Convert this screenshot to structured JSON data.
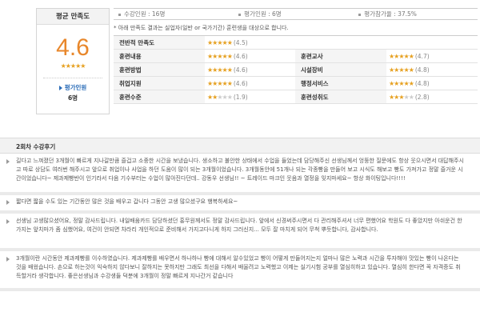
{
  "summary": {
    "title": "평균 만족도",
    "score": "4.6",
    "stars": "★★★★★",
    "rater_label": "평가인원",
    "rater_count": "6명"
  },
  "stats": [
    {
      "label": "수강인원 : 16명"
    },
    {
      "label": "평가인원 : 6명"
    },
    {
      "label": "평가참가율 : 37.5%"
    }
  ],
  "note": "* 아래 만족도 결과는 실업자(일반 or 국가기간) 훈련생을 대상으로 합니다.",
  "grid": {
    "overall": {
      "label": "전반적 만족도",
      "filled": "★★★★★",
      "empty": "",
      "score": "(4.5)"
    },
    "rows": [
      [
        {
          "label": "훈련내용",
          "filled": "★★★★★",
          "empty": "",
          "score": "(4.6)"
        },
        {
          "label": "훈련교사",
          "filled": "★★★★★",
          "empty": "",
          "score": "(4.7)"
        }
      ],
      [
        {
          "label": "훈련방법",
          "filled": "★★★★★",
          "empty": "",
          "score": "(4.6)"
        },
        {
          "label": "시설장비",
          "filled": "★★★★★",
          "empty": "",
          "score": "(4.8)"
        }
      ],
      [
        {
          "label": "취업지원",
          "filled": "★★★★★",
          "empty": "",
          "score": "(4.6)"
        },
        {
          "label": "행정서비스",
          "filled": "★★★★★",
          "empty": "",
          "score": "(4.8)"
        }
      ],
      [
        {
          "label": "훈련수준",
          "filled": "★★",
          "empty": "★★★",
          "score": "(1.9)"
        },
        {
          "label": "훈련성취도",
          "filled": "★★★",
          "empty": "★★",
          "score": "(2.8)"
        }
      ]
    ]
  },
  "reviews": {
    "title": "2회차 수강후기",
    "items": [
      {
        "text": "길다고 느껴졌던 3개월이 빠르게 지나갈만큼 즐겁고 소중한 시간을 보냈습니다. 생소하고 불안한 상태에서 수업을 들었는데 담당해주신 선생님께서 엉뚱한 질문에도 항상 웃으시면서 대답해주시고 따로 상담도 여러번 해주시고 앞으로 취업이나 사업을 하던 도움이 많이 되는 3개월이었습니다. 3개월동안에 51개나 되는 각종빵을 만들어 보고 시식도 해보고 빵도 가져가고 정말 즐거운 시간이었습니다~ 제과제빵반이 인기라서 다음 기수부터는 수업이 많아진다던데.. 강동우 선생님!! ~ 트레이드 마크인 웃음과 열정을 잊지마세요~ 항상 화이팅입니다!!!!"
      },
      {
        "text": "짧다면 짧을 수도 있는 기간동안 많은 것을 배우고 갑니다 그동안 고생 많으셨구요 행복하세요~"
      },
      {
        "text": "선생님 고생많으셨어요, 정말 감사드립니다. 내일배움카드 담당하셨던 홍무원께서도 정말 감사드립니다. 앞에서 신경써주시면서 다 관리해주셔서 너무 편했어요 학원도 다 좋았지만 아쉬운건 한가지는 앞치마가 좀 심했어요, 여건이 안되면 차라리 개인적으로 준비해서 가지고다니게 하지 그러신지... 모두 잘 마치게 되어 무척 뿌듯합니다, 감사합니다."
      },
      {
        "text": "3개월이란 시간동안 제과제빵를 이수하였습니다. 제과제빵를 배우면서 하나하나 빵에 대해서 알수있었고 빵이 어떻게 만들어지는지 얼마나 많은 노력과 시간을 투자해야 맛있는 빵이 나온다는 것을 배웠습니다. 손으로 하는것이 익숙하지 않다보니 잘하지는 못하지만 그래도 최선을 다해서 배울려고 노력했고 이제는 실기시험 공부를 열심히하고 있습니다. 열심히 한다면 꼭 자격증도 취득할거라 생각합니다. 좋은선생님과 수강생들 덕분에 3개월이 정말 빠르게 지나간거 같습니다"
      }
    ]
  }
}
